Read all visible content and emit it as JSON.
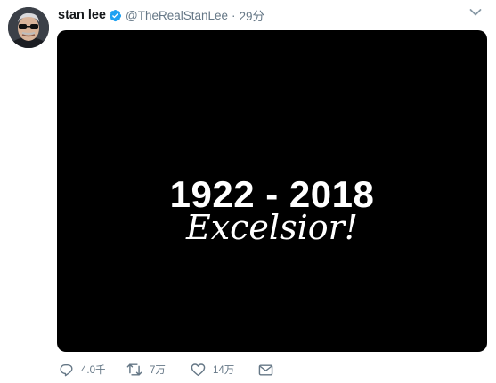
{
  "tweet": {
    "display_name": "stan lee",
    "handle": "@TheRealStanLee",
    "separator": "·",
    "timestamp": "29分",
    "verified_icon": "verified-badge-icon",
    "caret_icon": "chevron-down-icon",
    "media": {
      "years_text": "1922 - 2018",
      "motto_text": "Excelsior!",
      "background": "#000000"
    },
    "actions": {
      "reply_count": "4.0千",
      "retweet_count": "7万",
      "like_count": "14万"
    }
  },
  "colors": {
    "verified_blue": "#1da1f2",
    "muted_text": "#657786",
    "name_text": "#14171a"
  }
}
